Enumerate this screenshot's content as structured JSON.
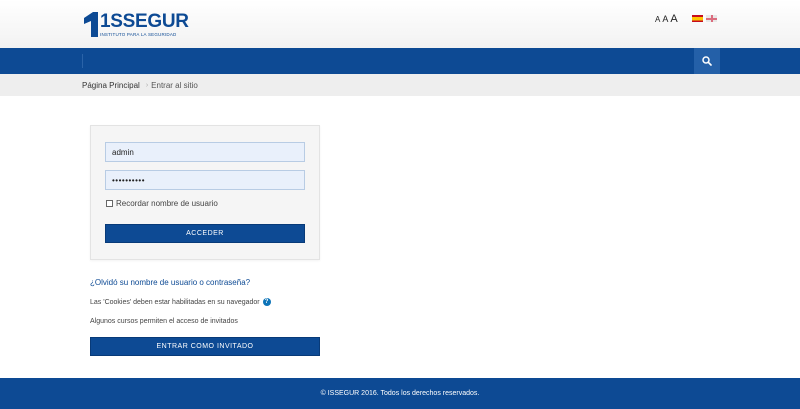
{
  "header": {
    "logo_name": "1SSEGUR",
    "logo_tagline": "INSTITUTO PARA LA SEGURIDAD",
    "font_size_small": "A",
    "font_size_medium": "A",
    "font_size_large": "A",
    "languages": [
      "es-flag-icon",
      "uk-flag-icon"
    ]
  },
  "navbar": {
    "search_icon": "search-icon"
  },
  "breadcrumb": {
    "home": "Página Principal",
    "current": "Entrar al sitio"
  },
  "login": {
    "username_value": "admin",
    "password_value": "••••••••••",
    "remember_label": "Recordar nombre de usuario",
    "submit_label": "ACCEDER"
  },
  "links": {
    "forgot": "¿Olvidó su nombre de usuario o contraseña?",
    "cookies_notice": "Las 'Cookies' deben estar habilitadas en su navegador",
    "guest_notice": "Algunos cursos permiten el acceso de invitados",
    "guest_button": "ENTRAR COMO INVITADO"
  },
  "footer": {
    "copyright": "© ISSEGUR 2016. Todos los derechos reservados."
  },
  "colors": {
    "brand_blue": "#0d4a94",
    "input_bg": "#e9f0fb"
  }
}
